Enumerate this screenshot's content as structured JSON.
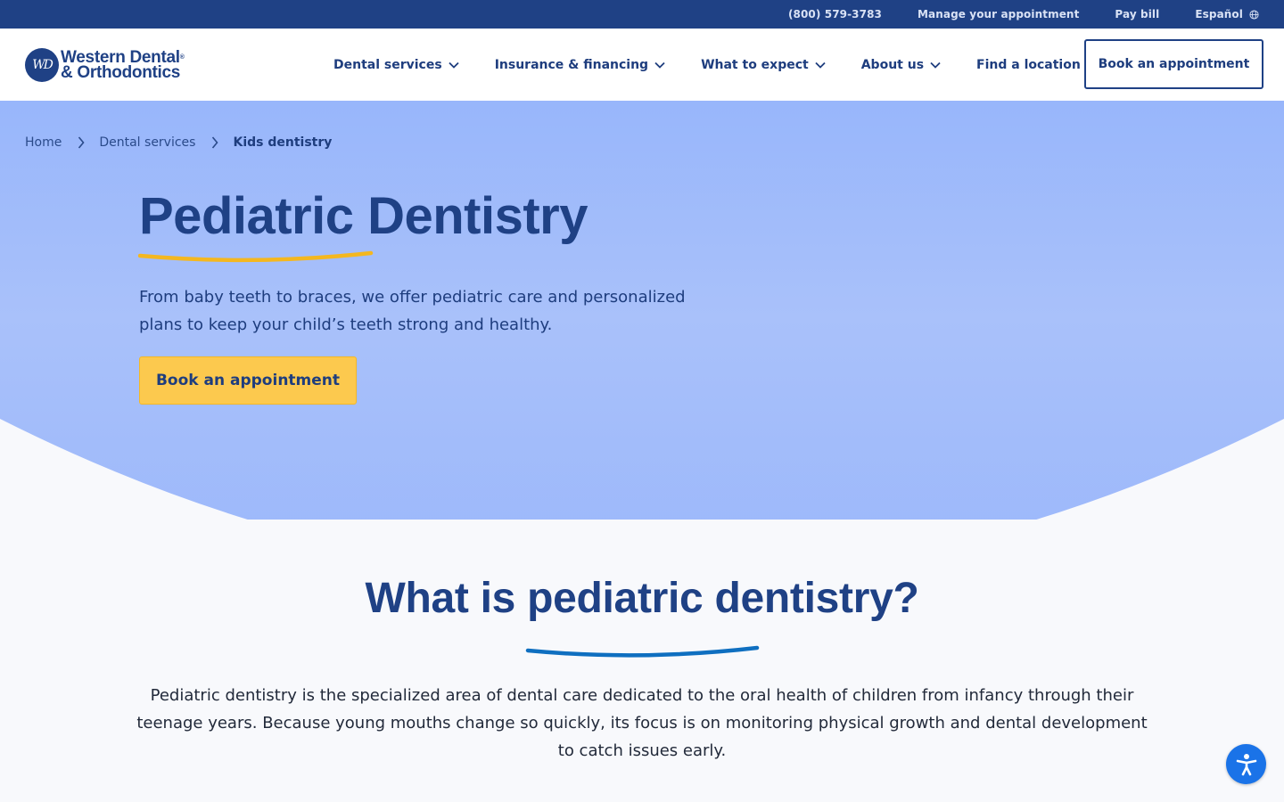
{
  "topbar": {
    "phone": "(800) 579-3783",
    "manage": "Manage your appointment",
    "pay": "Pay bill",
    "language": "Español"
  },
  "logo": {
    "monogram": "WD",
    "line1": "Western Dental",
    "line2": "& Orthodontics",
    "registered": "®"
  },
  "nav": {
    "items": [
      {
        "label": "Dental services"
      },
      {
        "label": "Insurance & financing"
      },
      {
        "label": "What to expect"
      },
      {
        "label": "About us"
      },
      {
        "label": "Find a location"
      }
    ],
    "cta": "Book an appointment"
  },
  "breadcrumb": {
    "home": "Home",
    "parent": "Dental services",
    "current": "Kids dentistry"
  },
  "hero": {
    "title": "Pediatric Dentistry",
    "text": "From baby teeth to braces, we offer pediatric care and personalized plans to keep your child’s teeth strong and healthy.",
    "cta": "Book an appointment"
  },
  "section": {
    "title": "What is pediatric dentistry?",
    "text": "Pediatric dentistry is the specialized area of dental care dedicated to the oral health of children from infancy through their teenage years. Because young mouths change so quickly, its focus is on monitoring physical growth and dental development to catch issues early."
  },
  "colors": {
    "brand_navy": "#1f4185",
    "hero_blue": "#a3bdf9",
    "accent_yellow": "#fcc94e",
    "underline_blue": "#0f6fc0",
    "a11y_blue": "#1a73e8"
  },
  "icons": {
    "globe": "globe-icon",
    "chevron": "chevron-down-icon",
    "breadcrumb_separator": "chevron-right-icon",
    "accessibility": "accessibility-icon"
  }
}
